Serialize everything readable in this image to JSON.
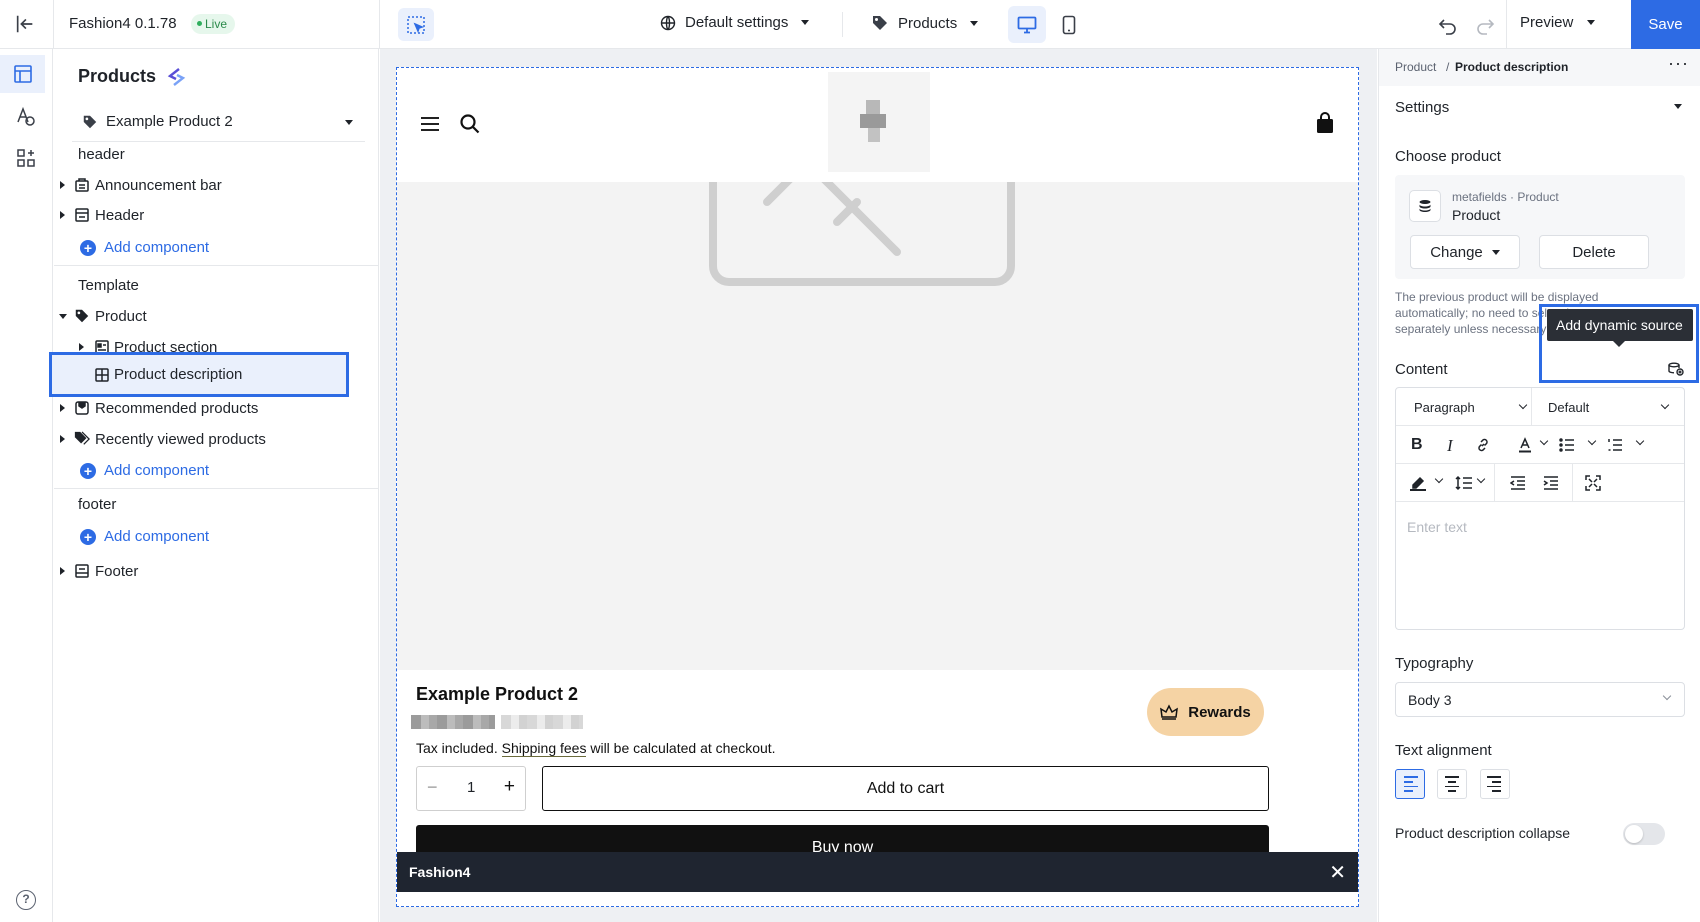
{
  "app": {
    "name": "Fashion4 0.1.78",
    "status": "Live"
  },
  "toolbar": {
    "settings_label": "Default settings",
    "page_type_label": "Products",
    "preview_label": "Preview",
    "save_label": "Save"
  },
  "left_panel": {
    "title": "Products",
    "selected_product": "Example Product 2",
    "groups": {
      "header": {
        "label": "header",
        "items": [
          "Announcement bar",
          "Header"
        ],
        "add_label": "Add component"
      },
      "template": {
        "label": "Template",
        "parent": "Product",
        "children": [
          "Product section",
          "Product description"
        ],
        "items": [
          "Recommended products",
          "Recently viewed products"
        ],
        "add_label": "Add component"
      },
      "footer": {
        "label": "footer",
        "add_label": "Add component",
        "items": [
          "Footer"
        ]
      }
    }
  },
  "canvas": {
    "product_title": "Example Product 2",
    "tax_prefix": "Tax included.",
    "tax_link": "Shipping fees",
    "tax_suffix": "will be calculated at checkout.",
    "rewards_label": "Rewards",
    "quantity": "1",
    "quantity_minus": "−",
    "quantity_plus": "+",
    "add_to_cart": "Add to cart",
    "buy_now": "Buy now",
    "bottom_bar_name": "Fashion4",
    "bottom_bar_close": "✕"
  },
  "right_panel": {
    "breadcrumb": [
      "Product",
      "Product description"
    ],
    "breadcrumb_sep": "/",
    "more": "···",
    "settings_title": "Settings",
    "choose_product_label": "Choose product",
    "source": {
      "subtitle": "metafields · Product",
      "title": "Product"
    },
    "change_label": "Change",
    "delete_label": "Delete",
    "hint": "The previous product will be displayed automatically; no need to select it separately unless necessary",
    "tooltip": "Add dynamic source",
    "content_label": "Content",
    "block_type": "Paragraph",
    "font_variant": "Default",
    "editor_placeholder": "Enter text",
    "typography_label": "Typography",
    "typography_value": "Body 3",
    "text_alignment_label": "Text alignment",
    "text_alignment_value": "left",
    "collapse_label": "Product description collapse",
    "collapse_enabled": false
  },
  "colors": {
    "accent": "#2d6be4",
    "rewards": "#f5d3a4",
    "live": "#2a8a4a"
  }
}
